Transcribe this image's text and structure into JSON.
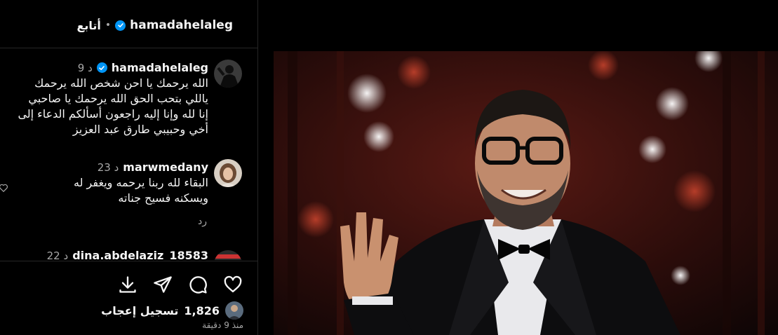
{
  "header": {
    "username": "hamadahelaleg",
    "separator": "•",
    "follow_label": "أتابع"
  },
  "comments": [
    {
      "username": "hamadahelaleg",
      "verified": true,
      "time": "9 د",
      "lines": [
        "الله يرحمك يا احن شخص الله يرحمك",
        "ياللي بتحب الحق الله يرحمك يا صاحبي",
        "إنا لله وإنا إليه راجعون أسألكم الدعاء إلى",
        "أخي وحبيبي طارق عبد العزيز"
      ]
    },
    {
      "username": "marwmedany",
      "time": "23 د",
      "lines": [
        "البقاء لله ربنا يرحمه ويغفر له",
        "ويسكنه فسيح جناته"
      ],
      "reply_label": "رد"
    },
    {
      "username": "dina.abdelaziz_18583",
      "time": "22 د"
    }
  ],
  "actions": {
    "like_icon": "heart-icon",
    "comment_icon": "comment-icon",
    "share_icon": "send-icon",
    "save_icon": "download-icon"
  },
  "likes": {
    "count": "1,826",
    "label": "تسجيل إعجاب"
  },
  "posted": "منذ 9 دقيقة",
  "colors": {
    "background": "#000000",
    "text": "#f5f5f5",
    "secondary": "#a8a8a8",
    "verified": "#0095f6",
    "divider": "#262626"
  }
}
